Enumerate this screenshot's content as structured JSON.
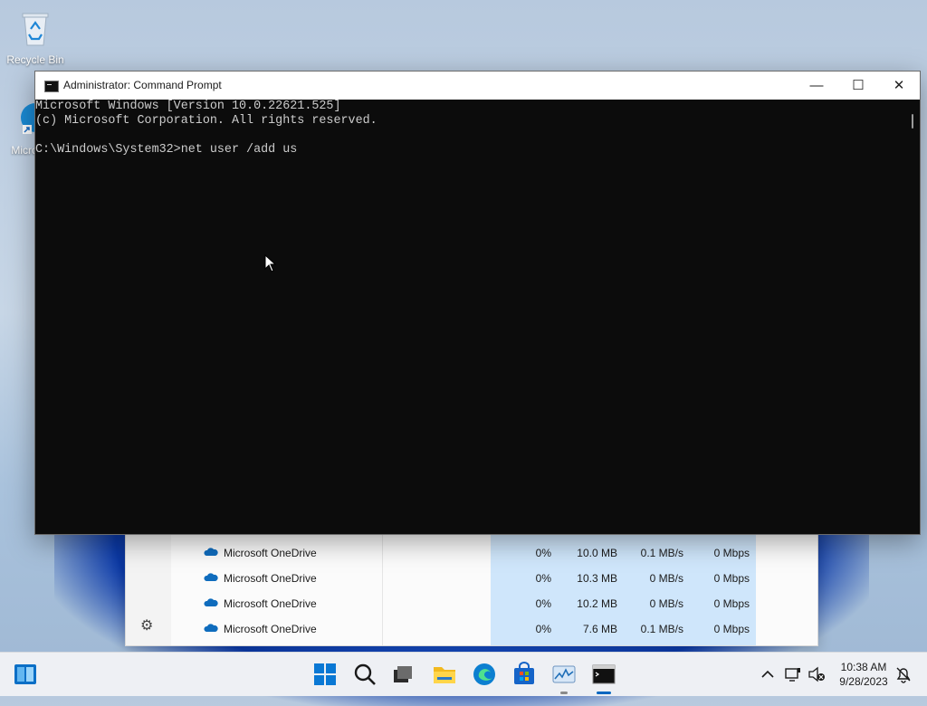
{
  "desktop": {
    "icons": [
      {
        "name": "recycle-bin",
        "label": "Recycle Bin"
      },
      {
        "name": "microsoft-edge",
        "label": "Micro Ed"
      }
    ]
  },
  "cmd_window": {
    "title": "Administrator: Command Prompt",
    "lines": [
      "Microsoft Windows [Version 10.0.22621.525]",
      "(c) Microsoft Corporation. All rights reserved.",
      "",
      "C:\\Windows\\System32>net user /add us"
    ],
    "buttons": {
      "minimize": "—",
      "maximize": "☐",
      "close": "✕"
    }
  },
  "task_manager": {
    "rows": [
      {
        "name": "Microsoft OneDrive",
        "cpu": "0%",
        "memory": "10.0 MB",
        "disk": "0.1 MB/s",
        "network": "0 Mbps"
      },
      {
        "name": "Microsoft OneDrive",
        "cpu": "0%",
        "memory": "10.3 MB",
        "disk": "0 MB/s",
        "network": "0 Mbps"
      },
      {
        "name": "Microsoft OneDrive",
        "cpu": "0%",
        "memory": "10.2 MB",
        "disk": "0 MB/s",
        "network": "0 Mbps"
      },
      {
        "name": "Microsoft OneDrive",
        "cpu": "0%",
        "memory": "7.6 MB",
        "disk": "0.1 MB/s",
        "network": "0 Mbps"
      }
    ]
  },
  "taskbar": {
    "apps": [
      "start",
      "search",
      "task-view",
      "file-explorer",
      "edge",
      "microsoft-store",
      "task-manager",
      "command-prompt"
    ],
    "clock": {
      "time": "10:38 AM",
      "date": "9/28/2023"
    },
    "accent": "#0067c0"
  }
}
